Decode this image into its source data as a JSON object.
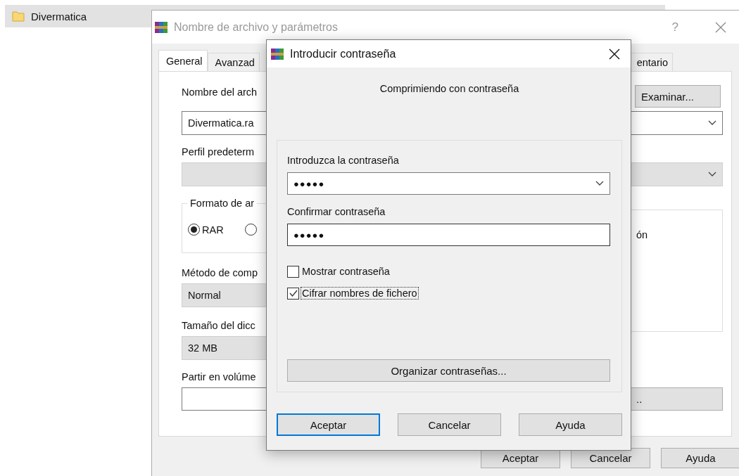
{
  "explorer_item": {
    "name": "Divermatica",
    "selected": true
  },
  "main_window": {
    "title": "Nombre de archivo y parámetros",
    "help": "?",
    "tabs": [
      {
        "label": "General",
        "selected": true
      },
      {
        "label": "Avanzad",
        "selected": false
      },
      {
        "label": "entario",
        "selected": false
      }
    ],
    "archive_name": {
      "label": "Nombre del arch",
      "value": "Divermatica.ra"
    },
    "browse_button": "Examinar...",
    "profile": {
      "label": "Perfil predeterm"
    },
    "format_group": {
      "label": "Formato de ar",
      "options": [
        {
          "label": "RAR",
          "selected": true
        },
        {
          "selected": false
        }
      ]
    },
    "options_panel_text": "ón",
    "method": {
      "label": "Método de comp",
      "value": "Normal"
    },
    "dictionary": {
      "label": "Tamaño del dicc",
      "value": "32 MB"
    },
    "split": {
      "label": "Partir en volúme"
    },
    "split_button": "..",
    "buttons": [
      {
        "label": "Aceptar",
        "default": false
      },
      {
        "label": "Cancelar",
        "default": false
      },
      {
        "label": "Ayuda",
        "default": false
      }
    ]
  },
  "password_dialog": {
    "title": "Introducir contraseña",
    "subtitle": "Comprimiendo con contraseña",
    "password": {
      "label": "Introduzca la contraseña",
      "value": "●●●●●"
    },
    "confirm": {
      "label": "Confirmar contraseña",
      "value": "●●●●●"
    },
    "checkboxes": [
      {
        "label": "Mostrar contraseña",
        "checked": false,
        "focused": false
      },
      {
        "label": "Cifrar nombres de fichero",
        "checked": true,
        "focused": true
      }
    ],
    "manage_button": "Organizar contraseñas...",
    "buttons": [
      {
        "label": "Aceptar",
        "default": true
      },
      {
        "label": "Cancelar",
        "default": false
      },
      {
        "label": "Ayuda",
        "default": false
      }
    ]
  }
}
